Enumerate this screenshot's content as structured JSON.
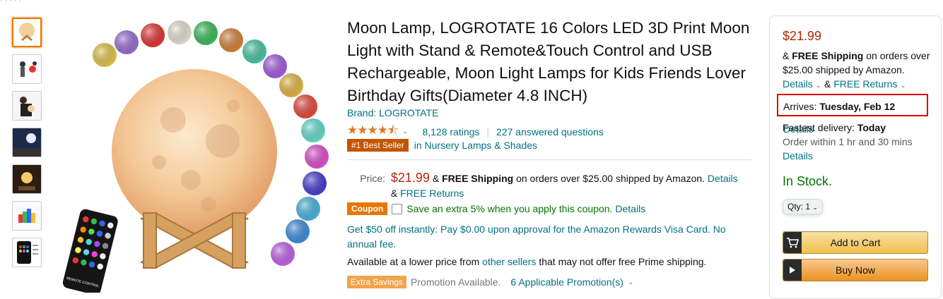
{
  "breadcrumb_fragment": "·   ·   ·   ·   ·",
  "title": "Moon Lamp, LOGROTATE 16 Colors LED 3D Print Moon Light with Stand & Remote&Touch Control and USB Rechargeable, Moon Light Lamps for Kids Friends Lover Birthday Gifts(Diameter 4.8 INCH)",
  "brand": "Brand: LOGROTATE",
  "rating": {
    "stars": "★★★★⯪",
    "ratings": "8,128 ratings",
    "separator": "|",
    "questions": "227 answered questions"
  },
  "best_seller": {
    "badge": "#1 Best Seller",
    "category": "in Nursery Lamps & Shades"
  },
  "price": {
    "label": "Price:",
    "value": "$21.99",
    "amp": "&",
    "free_shipping": "FREE Shipping",
    "ship_rest": "on orders over $25.00 shipped by Amazon.",
    "details": "Details",
    "amp2": "&",
    "free_returns": "FREE Returns"
  },
  "coupon": {
    "badge": "Coupon",
    "text": "Save an extra 5% when you apply this coupon.",
    "details": "Details"
  },
  "rewards_text": "Get $50 off instantly: Pay $0.00 upon approval for the Amazon Rewards Visa Card. No annual fee.",
  "availability": {
    "prefix": "Available at a lower price from",
    "link": "other sellers",
    "suffix": "that may not offer free Prime shipping."
  },
  "extra_savings": {
    "badge": "Extra Savings",
    "text": "Promotion Available.",
    "link": "6 Applicable Promotion(s)"
  },
  "buybox": {
    "price": "$21.99",
    "ship_amp": "&",
    "ship_bold": "FREE Shipping",
    "ship_rest": "on orders over $25.00 shipped by Amazon.",
    "details": "Details",
    "amp": "&",
    "free_returns": "FREE Returns",
    "arrives_label": "Arrives:",
    "arrives_date": "Tuesday, Feb 12",
    "arrives_details": "Details",
    "fastest_label": "Fastest delivery:",
    "fastest_day": "Today",
    "order_within": "Order within 1 hr and 30 mins",
    "fastest_details": "Details",
    "stock": "In Stock.",
    "qty": "Qty: 1",
    "add_to_cart": "Add to Cart",
    "buy_now": "Buy Now"
  },
  "remote_label": "REMOTE CONTROL",
  "colors": {
    "accent": "#007185",
    "price_red": "#b12704",
    "stock_green": "#007600",
    "best_seller": "#c45500",
    "coupon": "#e77600",
    "highlight": "#dd0000"
  },
  "orb_colors": [
    "#e6c84a",
    "#9b6fd6",
    "#e63535",
    "#e9e4d6",
    "#3bbf5a",
    "#d8843a",
    "#49c8a8",
    "#a45ee0",
    "#e8b845",
    "#e74c3c",
    "#66e0d0",
    "#e24fd0",
    "#4a3dd6",
    "#4ab6e0",
    "#3e8fe0",
    "#c264e8"
  ]
}
